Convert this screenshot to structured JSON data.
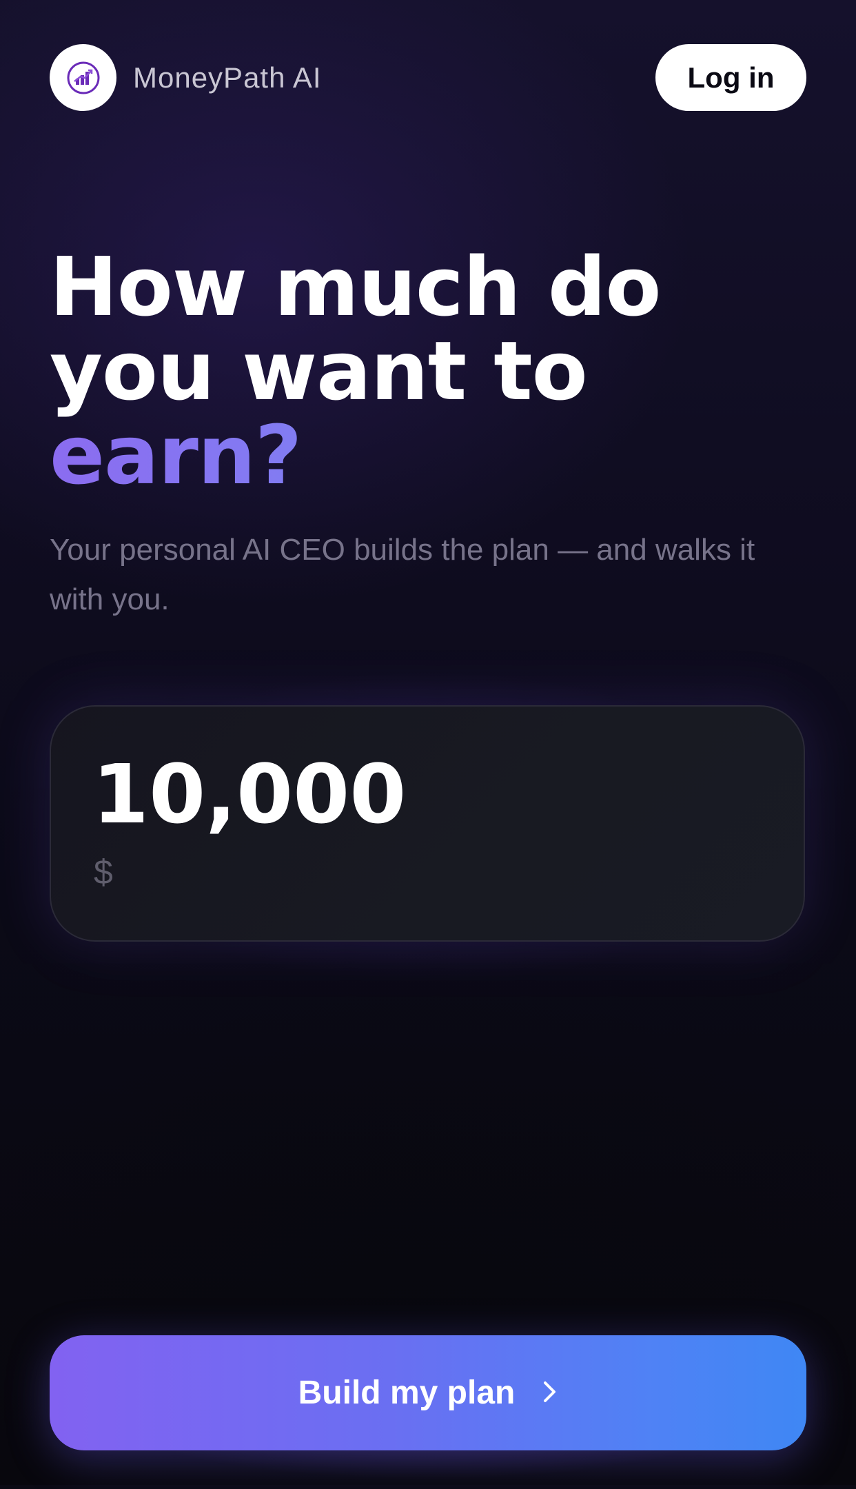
{
  "header": {
    "brand_name": "MoneyPath AI",
    "logo_icon": "chart-growth-icon",
    "login_label": "Log in"
  },
  "hero": {
    "headline_line1": "How much do",
    "headline_line2": "you want to",
    "headline_accent": "earn?",
    "subtitle": "Your personal AI CEO builds the plan — and walks it with you."
  },
  "amount": {
    "value": "10,000",
    "currency": "$"
  },
  "cta": {
    "label": "Build my plan",
    "icon": "chevron-right-icon"
  },
  "colors": {
    "background": "#0b0a14",
    "accent_start": "#8262f1",
    "accent_end": "#3f87f4",
    "button_light": "#ffffff"
  }
}
